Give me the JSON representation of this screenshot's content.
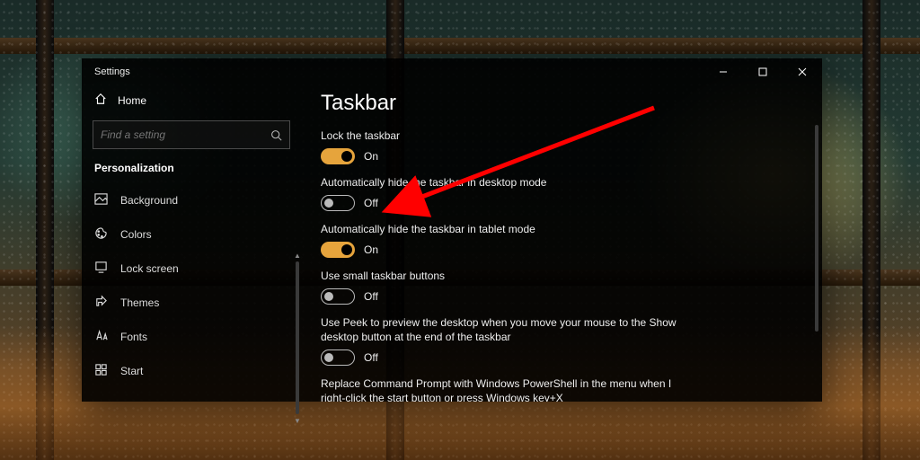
{
  "window": {
    "title": "Settings"
  },
  "sidebar": {
    "home": "Home",
    "search_placeholder": "Find a setting",
    "category": "Personalization",
    "items": [
      {
        "label": "Background"
      },
      {
        "label": "Colors"
      },
      {
        "label": "Lock screen"
      },
      {
        "label": "Themes"
      },
      {
        "label": "Fonts"
      },
      {
        "label": "Start"
      }
    ]
  },
  "page": {
    "heading": "Taskbar",
    "options": [
      {
        "label": "Lock the taskbar",
        "on": true,
        "state": "On"
      },
      {
        "label": "Automatically hide the taskbar in desktop mode",
        "on": false,
        "state": "Off"
      },
      {
        "label": "Automatically hide the taskbar in tablet mode",
        "on": true,
        "state": "On"
      },
      {
        "label": "Use small taskbar buttons",
        "on": false,
        "state": "Off"
      },
      {
        "label": "Use Peek to preview the desktop when you move your mouse to the Show desktop button at the end of the taskbar",
        "on": false,
        "state": "Off"
      },
      {
        "label": "Replace Command Prompt with Windows PowerShell in the menu when I right-click the start button or press Windows key+X",
        "on": null,
        "state": ""
      }
    ]
  },
  "colors": {
    "accent": "#e6a43c",
    "arrow": "#ff0000"
  }
}
